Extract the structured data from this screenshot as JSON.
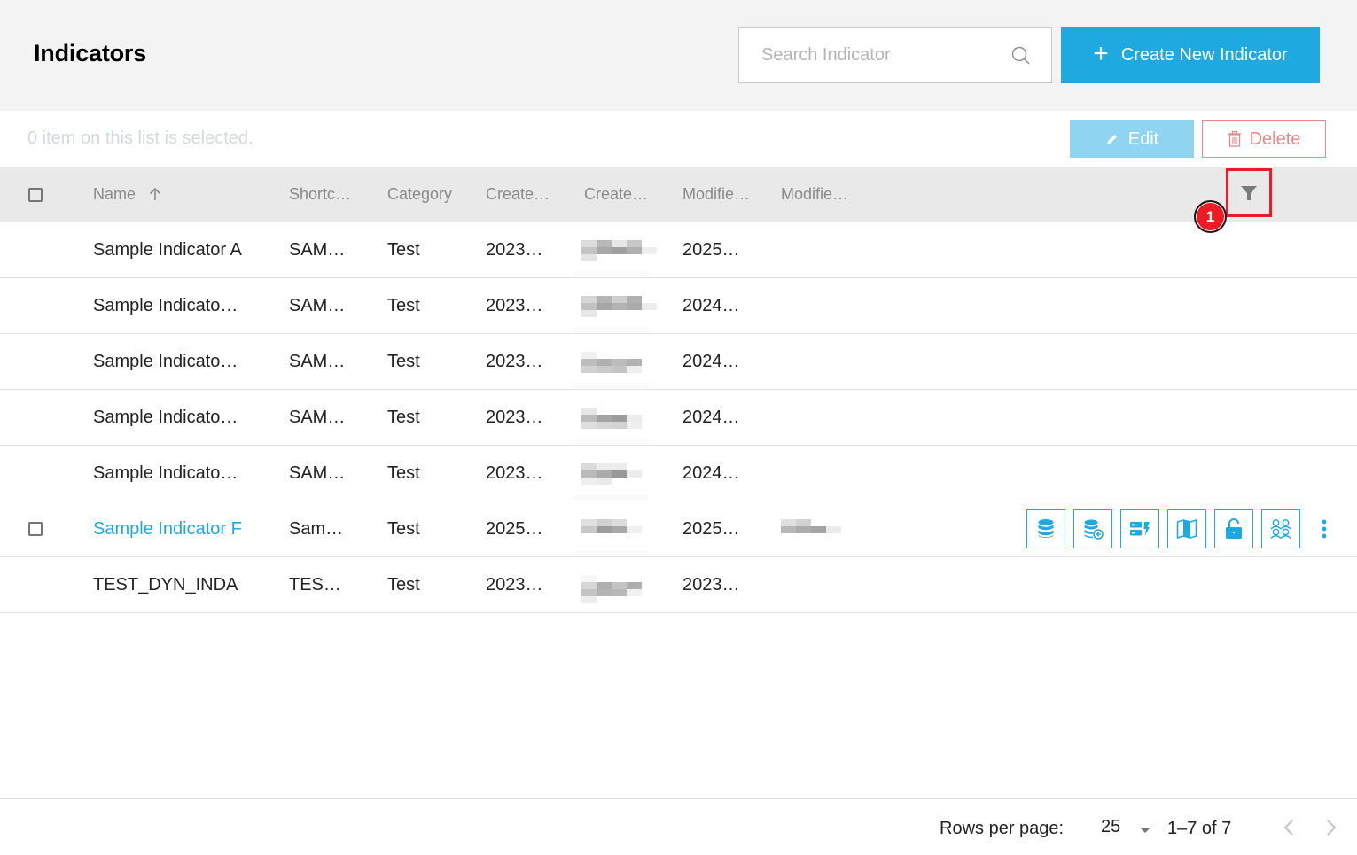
{
  "header": {
    "title": "Indicators",
    "search_placeholder": "Search Indicator",
    "search_value": "",
    "create_button": "Create New Indicator",
    "create_icon": "plus-icon",
    "search_icon": "search-icon"
  },
  "selection": {
    "text": "0 item on this list is selected.",
    "edit_label": "Edit",
    "edit_icon": "pencil-icon",
    "delete_label": "Delete",
    "delete_icon": "trash-icon"
  },
  "table": {
    "columns": [
      "Name",
      "Shortc…",
      "Category",
      "Create…",
      "Create…",
      "Modifie…",
      "Modifie…"
    ],
    "sort": {
      "column": "Name",
      "direction": "ascending",
      "icon": "arrow-up-icon"
    },
    "filter_icon": "filter-icon",
    "annotation_badge": "1",
    "rows": [
      {
        "name": "Sample Indicator A",
        "shortcode": "SAM…",
        "category": "Test",
        "created": "2023…",
        "created_by": "[obscured]",
        "modified": "2025…",
        "modified_by": "",
        "hovered": false
      },
      {
        "name": "Sample Indicato…",
        "shortcode": "SAM…",
        "category": "Test",
        "created": "2023…",
        "created_by": "[obscured]",
        "modified": "2024…",
        "modified_by": "",
        "hovered": false
      },
      {
        "name": "Sample Indicato…",
        "shortcode": "SAM…",
        "category": "Test",
        "created": "2023…",
        "created_by": "[obscured]",
        "modified": "2024…",
        "modified_by": "",
        "hovered": false
      },
      {
        "name": "Sample Indicato…",
        "shortcode": "SAM…",
        "category": "Test",
        "created": "2023…",
        "created_by": "[obscured]",
        "modified": "2024…",
        "modified_by": "",
        "hovered": false
      },
      {
        "name": "Sample Indicato…",
        "shortcode": "SAM…",
        "category": "Test",
        "created": "2023…",
        "created_by": "[obscured]",
        "modified": "2024…",
        "modified_by": "",
        "hovered": false
      },
      {
        "name": "Sample Indicator F",
        "shortcode": "Sam…",
        "category": "Test",
        "created": "2025…",
        "created_by": "[obscured]",
        "modified": "2025…",
        "modified_by": "[obscured]",
        "hovered": true
      },
      {
        "name": "TEST_DYN_INDA",
        "shortcode": "TES…",
        "category": "Test",
        "created": "2023…",
        "created_by": "[obscured]",
        "modified": "2023…",
        "modified_by": "",
        "hovered": false
      }
    ],
    "row_actions": [
      "database-icon",
      "database-import-icon",
      "server-bolt-icon",
      "map-icon",
      "unlock-icon",
      "users-group-icon",
      "more-vertical-icon"
    ]
  },
  "pagination": {
    "rows_per_page_label": "Rows per page:",
    "rows_per_page": "25",
    "range": "1–7 of 7",
    "prev_icon": "chevron-left-icon",
    "next_icon": "chevron-right-icon"
  },
  "colors": {
    "accent": "#1fa9e1",
    "edit_disabled": "#8fd4f1",
    "delete": "#e9898c",
    "annotation": "#ee1b24"
  }
}
